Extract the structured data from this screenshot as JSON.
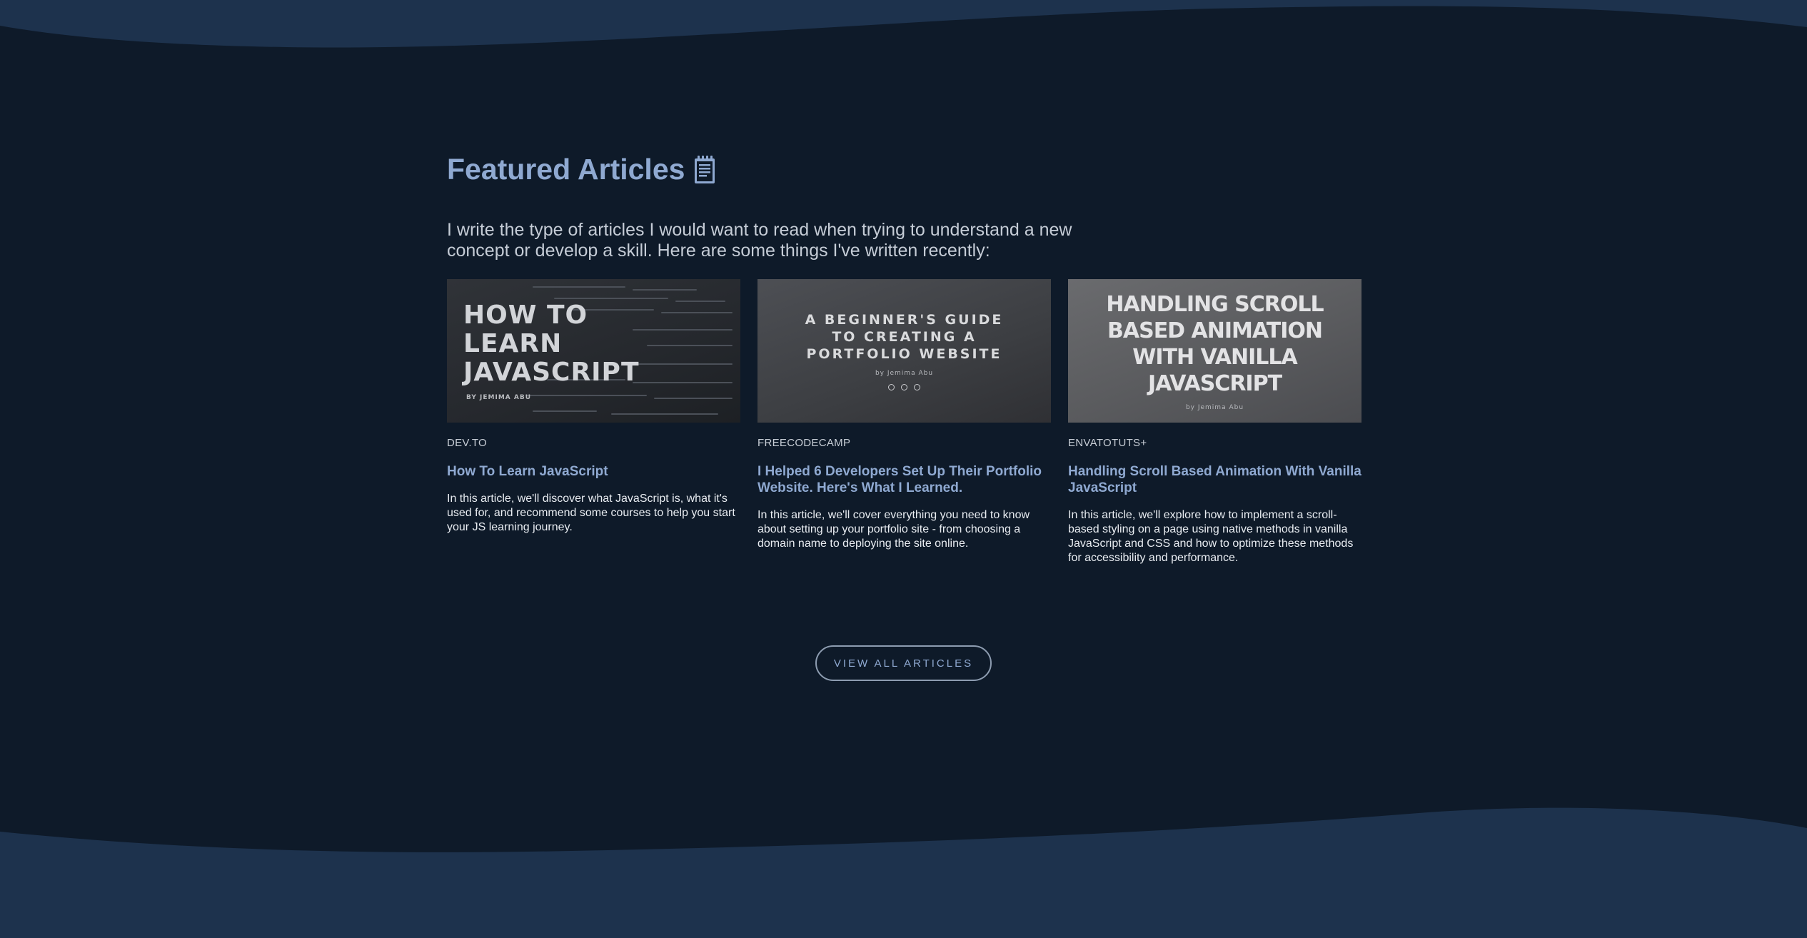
{
  "colors": {
    "page_bg": "#0e1a29",
    "wave_bg": "#1d324d",
    "accent": "#8fa9d1",
    "body_text": "#e8ecf1"
  },
  "section": {
    "heading": "Featured Articles",
    "heading_icon": "notepad-icon",
    "intro": "I write the type of articles I would want to read when trying to understand a new concept or develop a skill. Here are some things I've written recently:"
  },
  "articles": [
    {
      "source": "DEV.TO",
      "title": "How To Learn JavaScript",
      "description": "In this article, we'll discover what JavaScript is, what it's used for, and recommend some courses to help you start your JS learning journey.",
      "thumbnail_title": "HOW TO LEARN JAVASCRIPT",
      "thumbnail_byline": "BY JEMIMA ABU"
    },
    {
      "source": "FREECODECAMP",
      "title": "I Helped 6 Developers Set Up Their Portfolio Website. Here's What I Learned.",
      "description": "In this article, we'll cover everything you need to know about setting up your portfolio site - from choosing a domain name to deploying the site online.",
      "thumbnail_title": "A BEGINNER'S GUIDE TO CREATING A PORTFOLIO WEBSITE",
      "thumbnail_byline": "by Jemima Abu"
    },
    {
      "source": "ENVATOTUTS+",
      "title": "Handling Scroll Based Animation With Vanilla JavaScript",
      "description": "In this article, we'll explore how to implement a scroll-based styling on a page using native methods in vanilla JavaScript and CSS and how to optimize these methods for accessibility and performance.",
      "thumbnail_title": "HANDLING SCROLL BASED ANIMATION WITH VANILLA JAVASCRIPT",
      "thumbnail_byline": "by Jemima Abu"
    }
  ],
  "cta": {
    "label": "VIEW ALL ARTICLES"
  }
}
